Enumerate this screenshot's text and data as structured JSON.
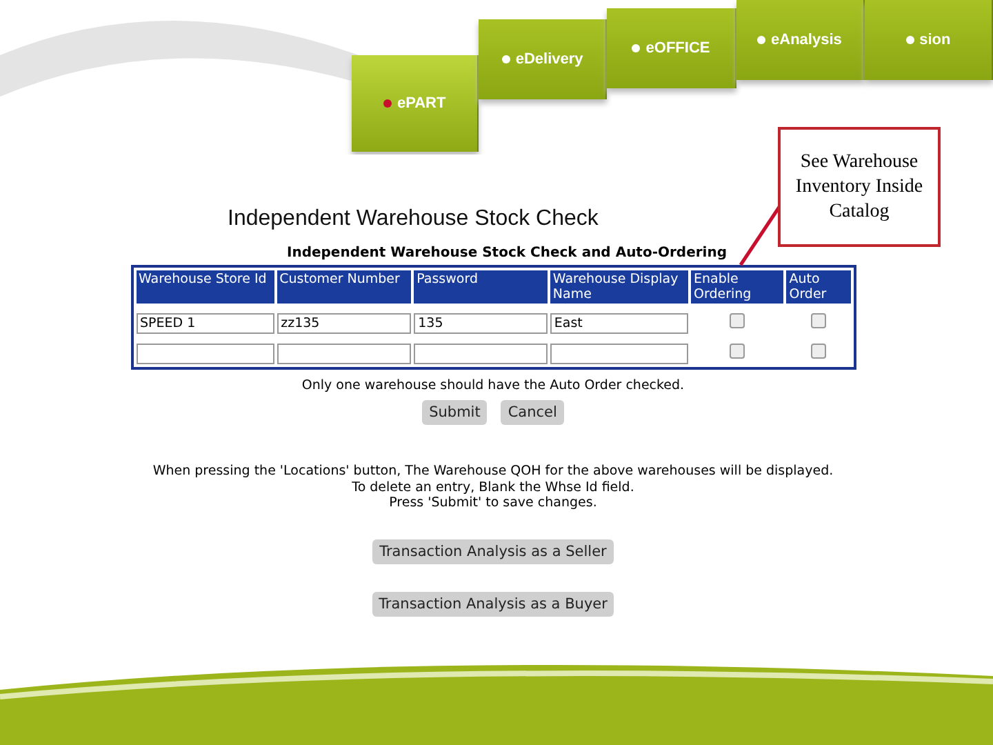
{
  "nav_tabs": [
    {
      "label": "ePART",
      "selected": true
    },
    {
      "label": "eDelivery",
      "selected": false
    },
    {
      "label": "eOFFICE",
      "selected": false
    },
    {
      "label": "eAnalysis",
      "selected": false
    },
    {
      "label": "sion",
      "selected": false
    }
  ],
  "page_title": "Independent Warehouse Stock Check",
  "form": {
    "title": "Independent Warehouse Stock Check and Auto-Ordering",
    "columns": [
      "Warehouse Store Id",
      "Customer Number",
      "Password",
      "Warehouse Display Name",
      "Enable Ordering",
      "Auto Order"
    ],
    "rows": [
      {
        "values": [
          "SPEED 1",
          "zz135",
          "135",
          "East"
        ],
        "enable_ordering": false,
        "auto_order": false
      },
      {
        "enable_ordering": false,
        "auto_order": false
      }
    ],
    "note": "Only one warehouse should have the Auto Order checked.",
    "buttons": [
      "Submit",
      "Cancel"
    ],
    "help": [
      "When pressing the 'Locations' button, The Warehouse QOH for the above warehouses will be displayed.",
      "To delete an entry, Blank the Whse Id field.",
      "Press 'Submit' to save changes."
    ],
    "report_buttons": [
      "Transaction Analysis as a Seller",
      "Transaction Analysis as a Buyer"
    ]
  },
  "callout": "See Warehouse Inventory Inside Catalog"
}
